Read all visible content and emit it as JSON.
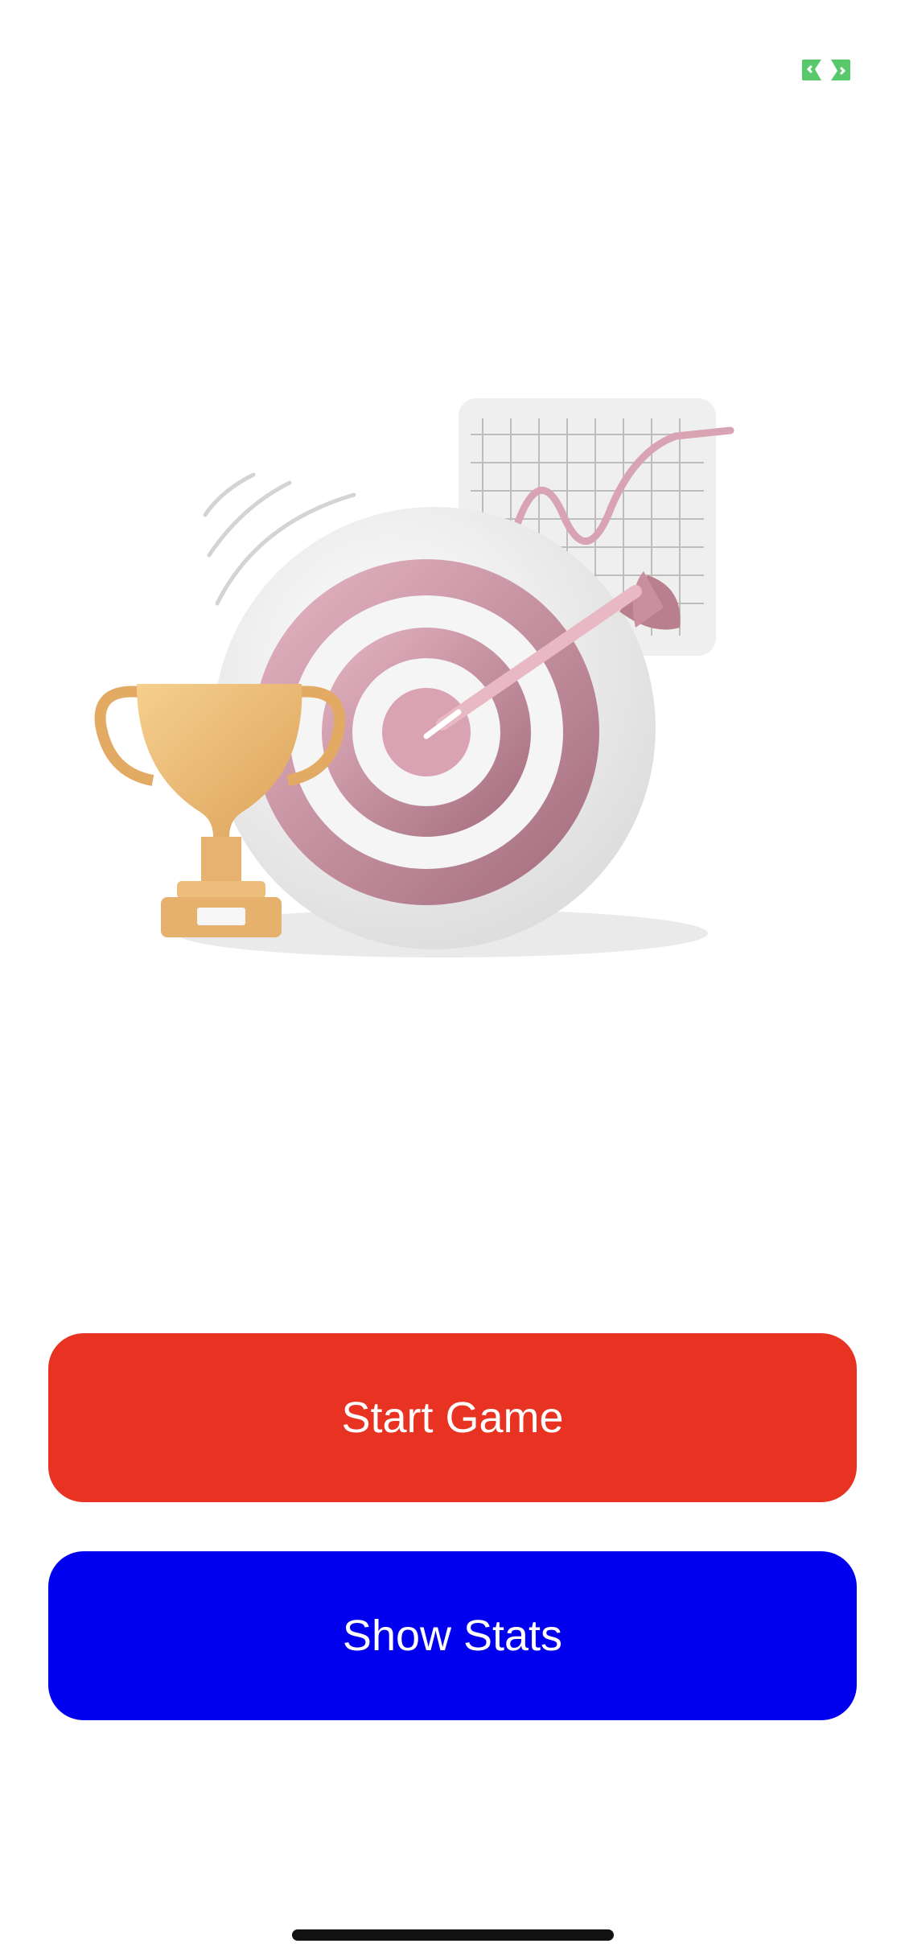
{
  "toolbar": {
    "fullscreen_icon": "expand-icon",
    "accent": "#58c96b"
  },
  "hero": {
    "image_subject": "trophy-dartboard-chart-illustration"
  },
  "actions": {
    "start_label": "Start Game",
    "start_color": "#e83323",
    "stats_label": "Show Stats",
    "stats_color": "#0000ee"
  }
}
